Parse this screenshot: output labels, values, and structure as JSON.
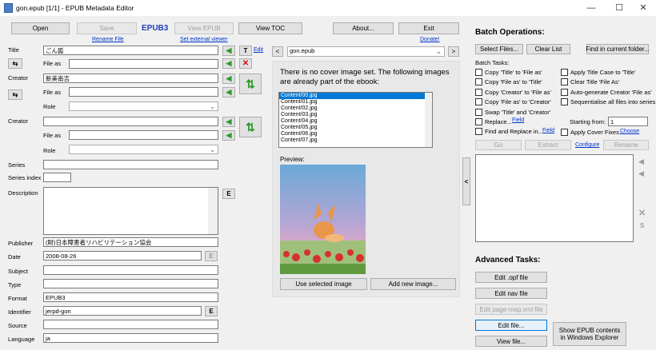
{
  "window": {
    "title": "gon.epub [1/1] - EPUB Metadata Editor",
    "controls": {
      "minimize": "—",
      "maximize": "☐",
      "close": "✕"
    }
  },
  "toolbar": {
    "open": "Open",
    "save": "Save",
    "epub_version": "EPUB3",
    "view_epub": "View EPUB",
    "view_toc": "View TOC",
    "about": "About...",
    "exit": "Exit",
    "rename_file": "Rename File",
    "set_external_viewer": "Set external viewer",
    "donate": "Donate!"
  },
  "fields": {
    "title_label": "Title",
    "title_value": "ごん狐",
    "edit_link": "Edit",
    "t_button": "T",
    "file_as_label": "File as",
    "title_file_as": "",
    "creator_label": "Creator",
    "creator1_value": "新美南吉",
    "creator1_file_as": "",
    "role_label": "Role",
    "creator1_role": "",
    "creator2_value": "",
    "creator2_file_as": "",
    "creator2_role": "",
    "series_label": "Series",
    "series_value": "",
    "series_index_label": "Series index",
    "series_index_value": "",
    "description_label": "Description",
    "description_value": "",
    "e_button": "E",
    "publisher_label": "Publisher",
    "publisher_value": "(財)日本障害者リハビリテーション協会",
    "date_label": "Date",
    "date_value": "2008-08-26",
    "subject_label": "Subject",
    "subject_value": "",
    "type_label": "Type",
    "type_value": "",
    "format_label": "Format",
    "format_value": "EPUB3",
    "identifier_label": "Identifier",
    "identifier_value": "jerpd-gon",
    "source_label": "Source",
    "source_value": "",
    "language_label": "Language",
    "language_value": "ja"
  },
  "cover": {
    "nav_prev": "<",
    "nav_next": ">",
    "file_select": "gon.epub",
    "message": "There is no cover image set.  The following images are already part of the ebook:",
    "images": [
      "Content/00.jpg",
      "Content/01.jpg",
      "Content/02.jpg",
      "Content/03.jpg",
      "Content/04.jpg",
      "Content/05.jpg",
      "Content/06.jpg",
      "Content/07.jpg"
    ],
    "selected_index": 0,
    "preview_label": "Preview:",
    "use_selected": "Use selected image",
    "add_new": "Add new image...",
    "collapse": "<"
  },
  "batch": {
    "heading": "Batch Operations:",
    "select_files": "Select Files...",
    "clear_list": "Clear List",
    "find_in_folder": "Find in current folder...",
    "tasks_label": "Batch Tasks:",
    "tasks_left": [
      "Copy 'Title' to 'File as'",
      "Copy 'File as' to 'Title'",
      "Copy 'Creator' to 'File as'",
      "Copy 'File as' to 'Creator'",
      "Swap 'Title' and 'Creator'",
      "Replace...",
      "Find and Replace in..."
    ],
    "field_link": "Field",
    "tasks_right": [
      "Apply Title Case to 'Title'",
      "Clear Title 'File As'",
      "Auto-generate Creator 'File as'",
      "Sequentialise all files into series:"
    ],
    "starting_from_label": "Starting from:",
    "starting_from_value": "1",
    "apply_cover_fixes": "Apply Cover Fixes...",
    "choose_link": "Choose",
    "go": "Go",
    "extract": "Extract",
    "configure": "Configure",
    "rename": "Rename",
    "side_s": "S"
  },
  "advanced": {
    "heading": "Advanced Tasks:",
    "edit_opf": "Edit .opf file",
    "edit_nav": "Edit nav file",
    "edit_page_map": "Edit page-map.xml file",
    "edit_file": "Edit file...",
    "view_file": "View file...",
    "show_in_explorer": "Show EPUB contents in Windows Explorer"
  }
}
